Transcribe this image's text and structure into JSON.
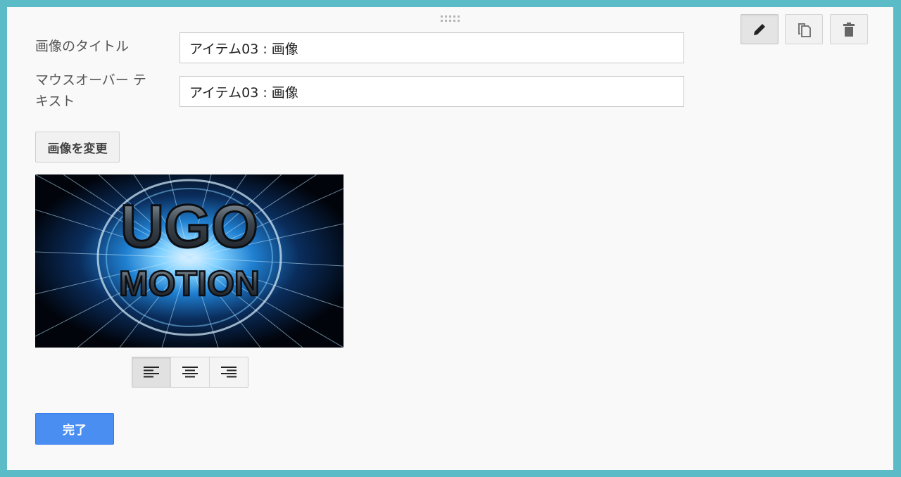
{
  "form": {
    "title_label": "画像のタイトル",
    "title_value": "アイテム03 : 画像",
    "hover_label_line1": "マウスオーバー テ",
    "hover_label_line2": "キスト",
    "hover_value": "アイテム03 : 画像",
    "change_image_label": "画像を変更",
    "done_label": "完了"
  },
  "image": {
    "line1": "UGO",
    "line2": "MOTION"
  },
  "toolbar": {
    "icons": [
      "pencil-icon",
      "copy-icon",
      "trash-icon"
    ],
    "active": "pencil-icon"
  },
  "alignment": {
    "options": [
      "align-left",
      "align-center",
      "align-right"
    ],
    "selected": "align-left"
  },
  "colors": {
    "frame": "#5bbcc8",
    "panel": "#f9f9f9",
    "primary_button": "#4b8ef1"
  }
}
